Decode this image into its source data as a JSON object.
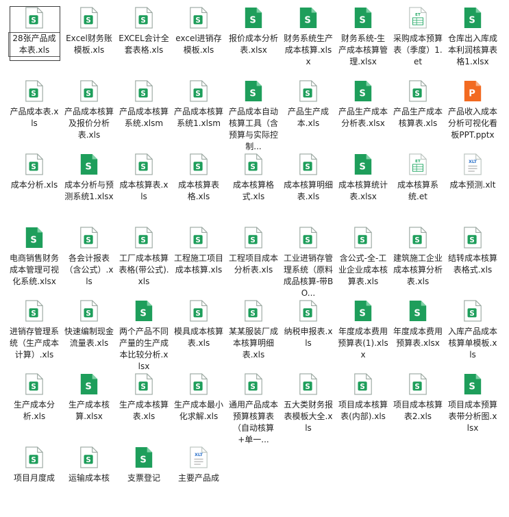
{
  "colors": {
    "excel_green": "#1e9e5b",
    "ppt_orange": "#f26a21",
    "et_green": "#24a866",
    "xlt_blue": "#2a6fc9",
    "light_border": "#cfcfcf"
  },
  "files": [
    {
      "name": "28张产品成本表.xls",
      "icon": "xls-outline",
      "selected": true
    },
    {
      "name": "Excel财务账模板.xls",
      "icon": "xls-outline"
    },
    {
      "name": "EXCEL会计全套表格.xls",
      "icon": "xls-outline"
    },
    {
      "name": "excel进销存模板.xls",
      "icon": "xls-outline"
    },
    {
      "name": "报价成本分析表.xlsx",
      "icon": "xlsx-solid"
    },
    {
      "name": "财务系统生产成本核算.xlsx",
      "icon": "xlsx-solid"
    },
    {
      "name": "财务系统-生产成本核算管理.xlsx",
      "icon": "xlsx-solid"
    },
    {
      "name": "采购成本预算表（季度）1.et",
      "icon": "et"
    },
    {
      "name": "仓库出入库成本利润核算表格1.xlsx",
      "icon": "xlsx-solid"
    },
    {
      "name": "产品成本表.xls",
      "icon": "xls-outline"
    },
    {
      "name": "产品成本核算及报价分析表.xls",
      "icon": "xls-outline"
    },
    {
      "name": "产品成本核算系统.xlsm",
      "icon": "xls-outline"
    },
    {
      "name": "产品成本核算系统1.xlsm",
      "icon": "xls-outline"
    },
    {
      "name": "产品成本自动核算工具（含预算与实际控制...",
      "icon": "xlsx-solid"
    },
    {
      "name": "产品生产成本.xls",
      "icon": "xls-outline"
    },
    {
      "name": "产品生产成本分析表.xlsx",
      "icon": "xlsx-solid"
    },
    {
      "name": "产品生产成本核算表.xls",
      "icon": "xls-outline"
    },
    {
      "name": "产品收入成本分析可视化看板PPT.pptx",
      "icon": "pptx"
    },
    {
      "name": "成本分析.xls",
      "icon": "xls-outline"
    },
    {
      "name": "成本分析与预测系统1.xlsx",
      "icon": "xlsx-solid"
    },
    {
      "name": "成本核算表.xls",
      "icon": "xls-outline"
    },
    {
      "name": "成本核算表格.xls",
      "icon": "xls-outline"
    },
    {
      "name": "成本核算格式.xls",
      "icon": "xls-outline"
    },
    {
      "name": "成本核算明细表.xls",
      "icon": "xls-outline"
    },
    {
      "name": "成本核算统计表.xlsx",
      "icon": "xlsx-solid"
    },
    {
      "name": "成本核算系统.et",
      "icon": "et"
    },
    {
      "name": "成本预测.xlt",
      "icon": "xlt"
    },
    {
      "name": "电商销售财务成本管理可视化系统.xlsx",
      "icon": "xlsx-solid"
    },
    {
      "name": "各会计报表（含公式）.xls",
      "icon": "xls-outline"
    },
    {
      "name": "工厂成本核算表格(带公式).xls",
      "icon": "xls-outline"
    },
    {
      "name": "工程施工项目成本核算.xls",
      "icon": "xls-outline"
    },
    {
      "name": "工程项目成本分析表.xls",
      "icon": "xls-outline"
    },
    {
      "name": "工业进销存管理系统（原料成品核算-带BO...",
      "icon": "xls-outline"
    },
    {
      "name": "含公式-全-工业企业成本核算表.xls",
      "icon": "xls-outline"
    },
    {
      "name": "建筑施工企业成本核算分析表.xls",
      "icon": "xls-outline"
    },
    {
      "name": "结转成本核算表格式.xls",
      "icon": "xls-outline"
    },
    {
      "name": "进销存管理系统（生产成本计算）.xls",
      "icon": "xls-outline"
    },
    {
      "name": "快速编制现金流量表.xls",
      "icon": "xls-outline"
    },
    {
      "name": "两个产品不同产量的生产成本比较分析.xlsx",
      "icon": "xlsx-solid"
    },
    {
      "name": "模具成本核算表.xls",
      "icon": "xls-outline"
    },
    {
      "name": "某某服装厂成本核算明细表.xls",
      "icon": "xls-outline"
    },
    {
      "name": "纳税申报表.xls",
      "icon": "xls-outline"
    },
    {
      "name": "年度成本费用预算表(1).xlsx",
      "icon": "xlsx-solid"
    },
    {
      "name": "年度成本费用预算表.xlsx",
      "icon": "xlsx-solid"
    },
    {
      "name": "入库产品成本核算单模板.xls",
      "icon": "xls-outline"
    },
    {
      "name": "生产成本分析.xls",
      "icon": "xls-outline"
    },
    {
      "name": "生产成本核算.xlsx",
      "icon": "xlsx-solid"
    },
    {
      "name": "生产成本核算表.xls",
      "icon": "xls-outline"
    },
    {
      "name": "生产成本最小化求解.xls",
      "icon": "xls-outline"
    },
    {
      "name": "通用产品成本预算核算表（自动核算+单一...",
      "icon": "xls-outline"
    },
    {
      "name": "五大类财务报表模板大全.xls",
      "icon": "xls-outline"
    },
    {
      "name": "项目成本核算表(内部).xls",
      "icon": "xls-outline"
    },
    {
      "name": "项目成本核算表2.xls",
      "icon": "xls-outline"
    },
    {
      "name": "项目成本预算表带分析图.xlsx",
      "icon": "xlsx-solid"
    },
    {
      "name": "项目月度成",
      "icon": "xls-outline"
    },
    {
      "name": "运输成本核",
      "icon": "xls-outline"
    },
    {
      "name": "支票登记",
      "icon": "xlsx-solid"
    },
    {
      "name": "主要产品成",
      "icon": "xlt"
    }
  ]
}
